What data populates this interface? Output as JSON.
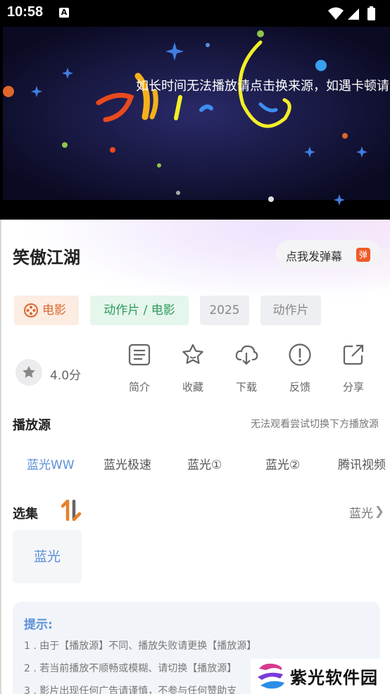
{
  "status_bar": {
    "time": "10:58",
    "notification_badge": "A",
    "accent": "#000000"
  },
  "player": {
    "marquee_text": "如长时间无法播放请点击换来源，如遇卡顿请"
  },
  "details": {
    "title": "笑傲江湖",
    "danmaku_button_label": "点我发弹幕",
    "danmaku_icon_char": "弹",
    "tags": [
      "电影",
      "动作片 / 电影",
      "2025",
      "动作片"
    ],
    "rating": "4.0分",
    "actions": [
      {
        "label": "简介",
        "icon": "document-icon"
      },
      {
        "label": "收藏",
        "icon": "star-icon"
      },
      {
        "label": "下载",
        "icon": "cloud-download-icon"
      },
      {
        "label": "反馈",
        "icon": "alert-icon"
      },
      {
        "label": "分享",
        "icon": "share-icon"
      }
    ]
  },
  "sources": {
    "title": "播放源",
    "hint": "无法观看尝试切换下方播放源",
    "tabs": [
      "蓝光WW",
      "蓝光极速",
      "蓝光①",
      "蓝光②",
      "腾讯视频"
    ],
    "active_index": 0
  },
  "episodes": {
    "title": "选集",
    "current_source": "蓝光",
    "items": [
      "蓝光"
    ]
  },
  "tips": {
    "title": "提示:",
    "lines": [
      "1 . 由于【播放源】不同、播放失败请更换【播放源】",
      "2 . 若当前播放不顺畅或模糊、请切换【播放源】",
      "3 . 影片出现任何广告请谨慎，不参与任何赞助支"
    ]
  },
  "watermark": {
    "text": "紫光软件园"
  },
  "colors": {
    "accent_blue": "#5b8fd6",
    "orange": "#f05a28",
    "green": "#2e9b5e"
  }
}
